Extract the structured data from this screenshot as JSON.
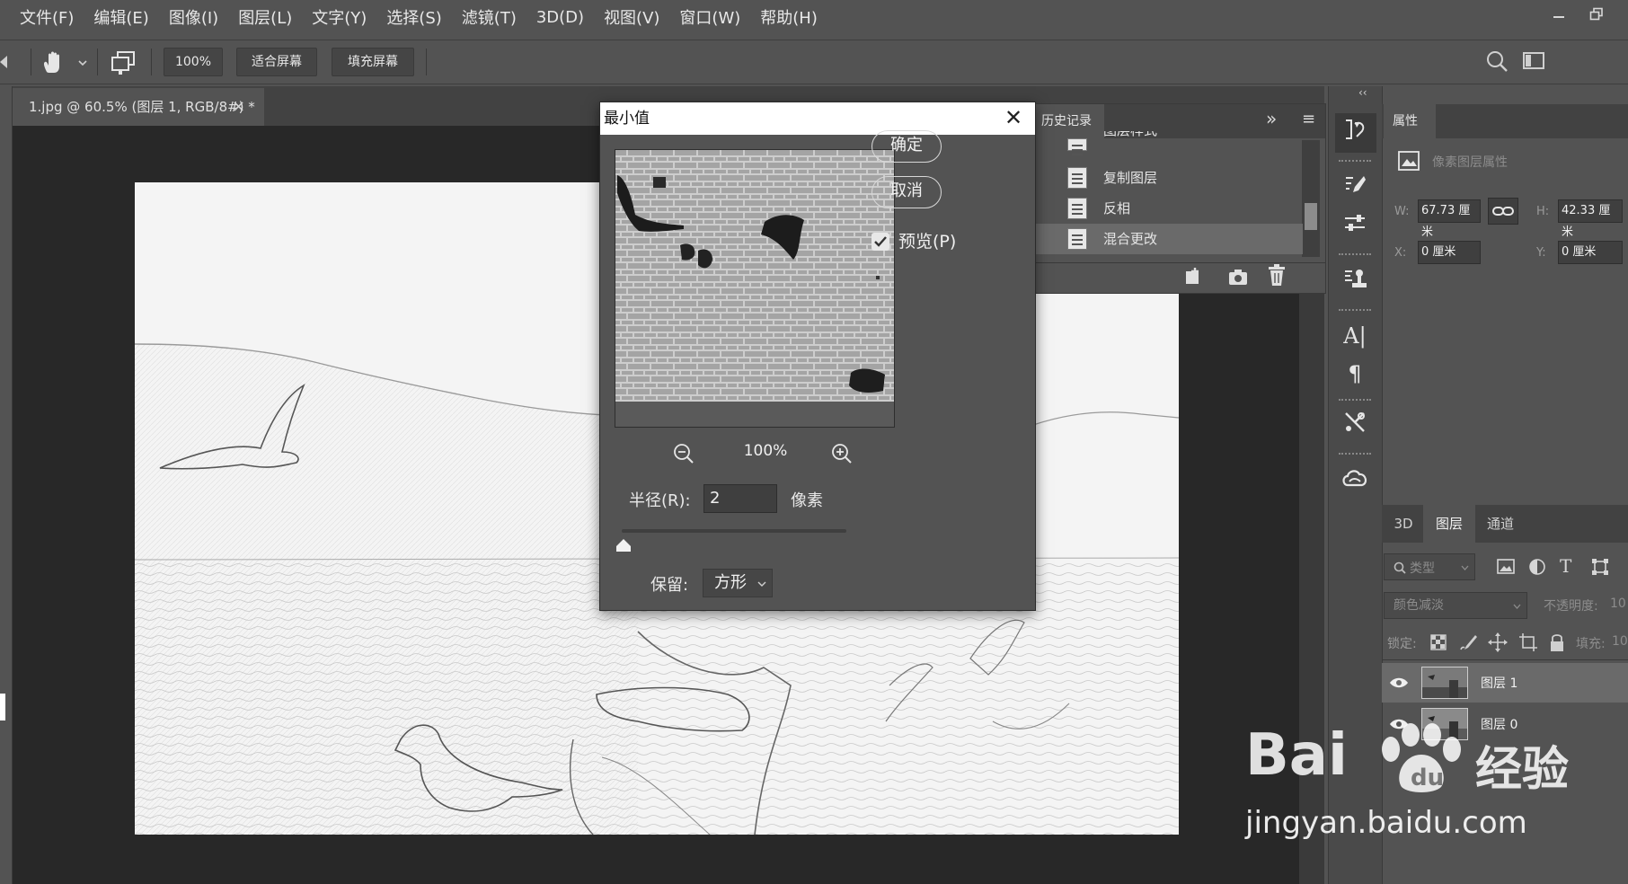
{
  "menubar": {
    "items": [
      "文件(F)",
      "编辑(E)",
      "图像(I)",
      "图层(L)",
      "文字(Y)",
      "选择(S)",
      "滤镜(T)",
      "3D(D)",
      "视图(V)",
      "窗口(W)",
      "帮助(H)"
    ],
    "minimize_icon": "minimize-icon",
    "restore_icon": "restore-window-icon"
  },
  "optionsbar": {
    "zoom_value": "100%",
    "fit_screen": "适合屏幕",
    "fill_screen": "填充屏幕"
  },
  "document": {
    "tab_title": "1.jpg @ 60.5% (图层 1, RGB/8#) *",
    "close_glyph": "×"
  },
  "dialog": {
    "title": "最小值",
    "close_glyph": "✕",
    "ok_label": "确定",
    "cancel_label": "取消",
    "preview_checkbox_label": "预览(P)",
    "preview_checked": true,
    "zoom_level": "100%",
    "radius_label": "半径(R):",
    "radius_value": "2",
    "radius_unit": "像素",
    "preserve_label": "保留:",
    "preserve_value": "方形"
  },
  "history": {
    "title": "历史记录",
    "items": [
      "图层样式",
      "复制图层",
      "反相",
      "混合更改"
    ],
    "expand_glyph": "»",
    "menu_glyph": "≡"
  },
  "properties": {
    "title": "属性",
    "subtitle": "像素图层属性",
    "w_label": "W:",
    "w_value": "67.73 厘米",
    "h_label": "H:",
    "h_value": "42.33 厘米",
    "x_label": "X:",
    "x_value": "0 厘米",
    "y_label": "Y:",
    "y_value": "0 厘米"
  },
  "layers": {
    "tabs": [
      "3D",
      "图层",
      "通道"
    ],
    "active_tab": "图层",
    "filter_placeholder": "类型",
    "blend_mode": "颜色减淡",
    "opacity_label": "不透明度:",
    "opacity_value": "10",
    "lock_label": "锁定:",
    "fill_label": "填充:",
    "fill_value": "10",
    "rows": [
      {
        "name": "图层 1",
        "visible": true
      },
      {
        "name": "图层 0",
        "visible": true
      }
    ]
  },
  "watermark": {
    "brand": "Bai",
    "brand_tail": "经验",
    "url": "jingyan.baidu.com"
  },
  "colors": {
    "ui_bg": "#535353",
    "canvas_bg": "#282828",
    "dialog_title_bg": "#ffffff"
  }
}
